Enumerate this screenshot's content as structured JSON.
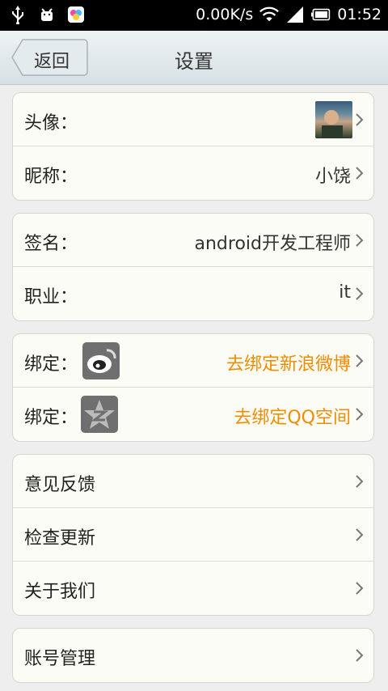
{
  "status_bar": {
    "speed": "0.00K/s",
    "time": "01:52",
    "icons": [
      "usb-icon",
      "android-debug-icon",
      "app-icon",
      "wifi-icon",
      "signal-icon",
      "battery-icon"
    ]
  },
  "header": {
    "back_label": "返回",
    "title": "设置"
  },
  "groups": {
    "profile": {
      "avatar_label": "头像：",
      "nickname_label": "昵称：",
      "nickname_value": "小饶"
    },
    "info": {
      "signature_label": "签名：",
      "signature_value": "android开发工程师",
      "job_label": "职业：",
      "job_value": "it"
    },
    "binding": {
      "weibo_label": "绑定：",
      "weibo_value": "去绑定新浪微博",
      "qzone_label": "绑定：",
      "qzone_value": "去绑定QQ空间"
    },
    "misc": {
      "feedback": "意见反馈",
      "update": "检查更新",
      "about": "关于我们"
    },
    "account": {
      "manage": "账号管理"
    }
  },
  "colors": {
    "accent": "#f08c00",
    "card_bg": "#fcfcf6",
    "page_bg": "#eeeeee"
  }
}
